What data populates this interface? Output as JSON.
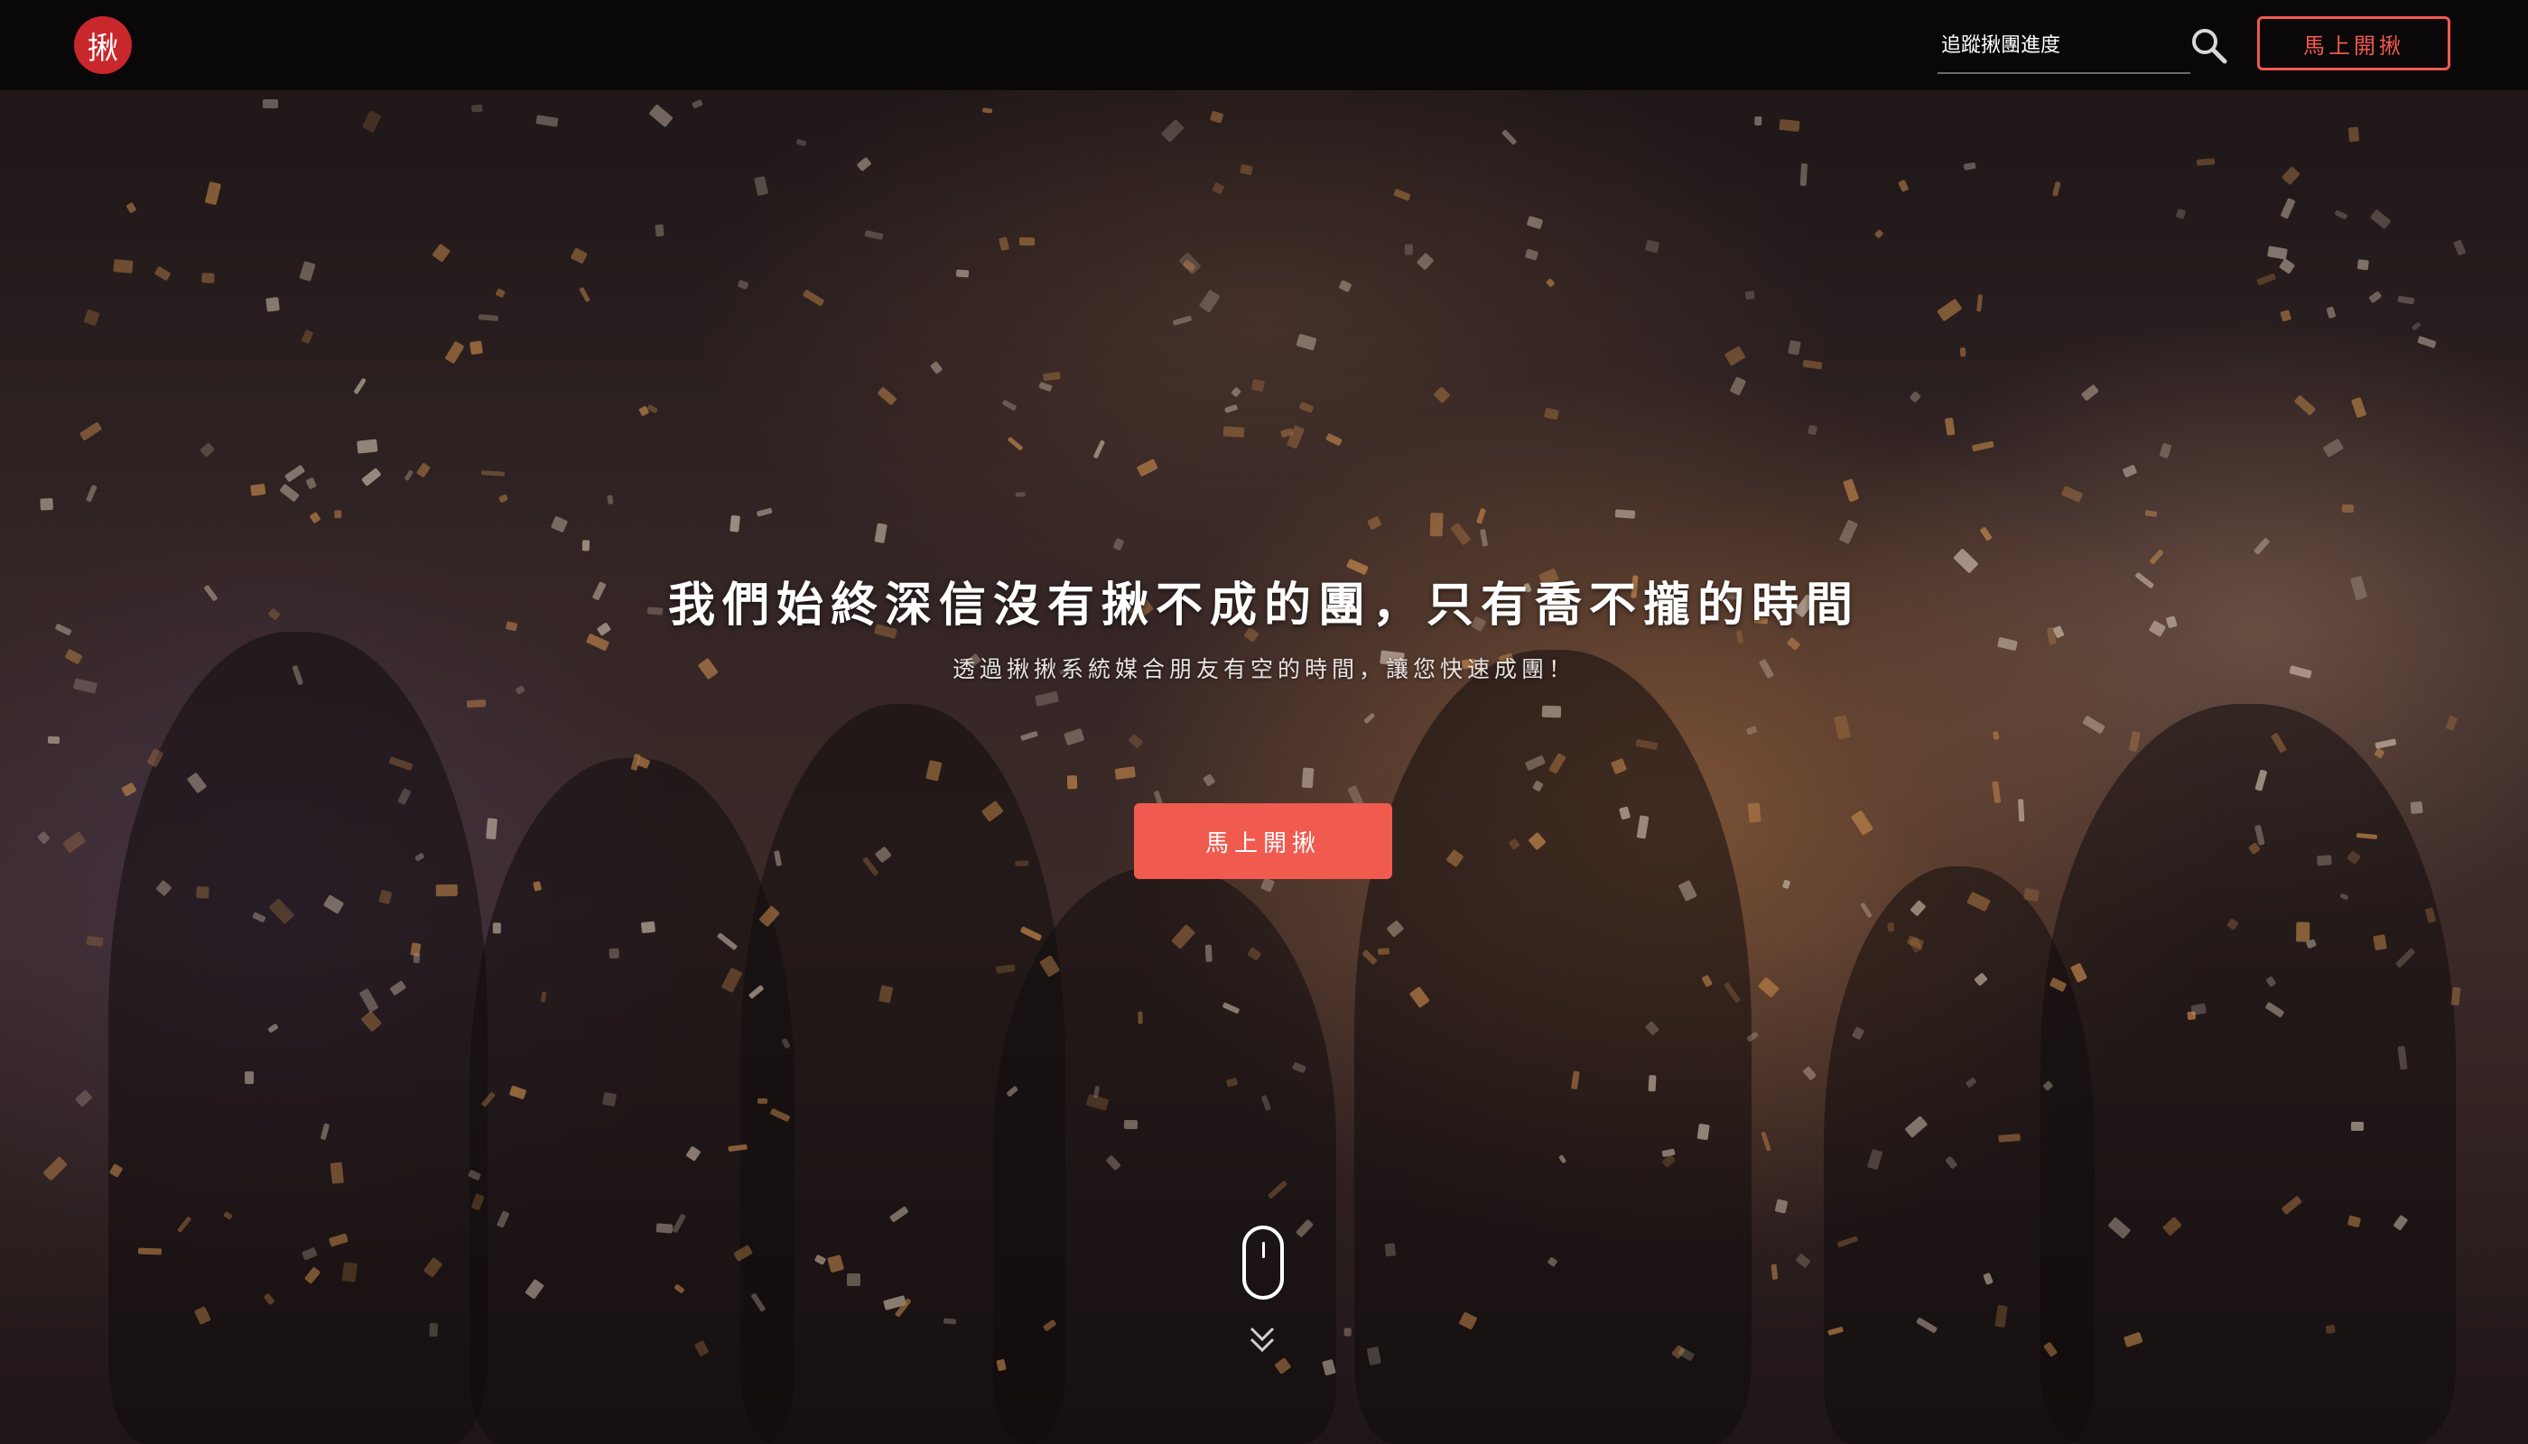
{
  "nav": {
    "logo_text": "揪",
    "search": {
      "placeholder": "追蹤揪團進度",
      "icon": "search-icon"
    },
    "cta_label": "馬上開揪"
  },
  "hero": {
    "headline": "我們始終深信沒有揪不成的團，只有喬不攏的時間",
    "subheadline": "透過揪揪系統媒合朋友有空的時間，讓您快速成團！",
    "cta_label": "馬上開揪",
    "scroll_indicator": {
      "icons": [
        "mouse-icon",
        "chevron-down-icon"
      ]
    }
  },
  "colors": {
    "accent": "#f05a4f",
    "logo_red": "#c8272c",
    "navbar_bg": "#080607",
    "text_light": "#ffffff"
  }
}
